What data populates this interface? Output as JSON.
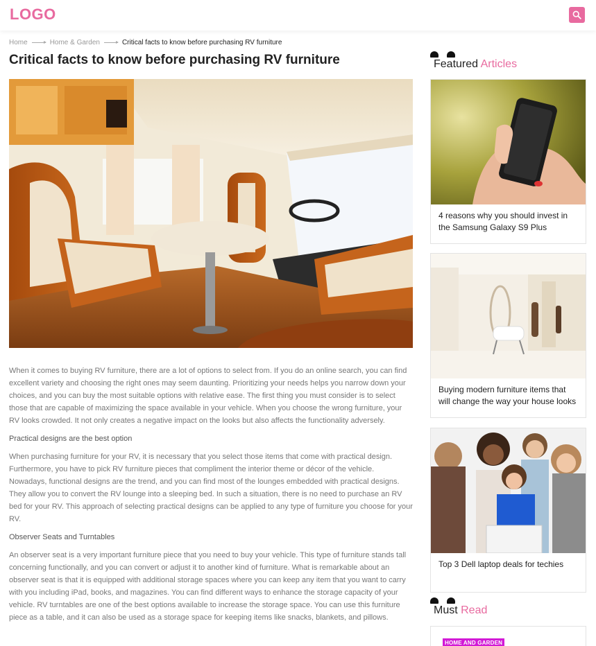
{
  "header": {
    "logo": "LOGO",
    "search_icon": "search-icon",
    "accent_color": "#e86a9f"
  },
  "breadcrumb": {
    "items": [
      "Home",
      "Home & Garden"
    ],
    "current": "Critical facts to know before purchasing RV furniture"
  },
  "article": {
    "title": "Critical facts to know before purchasing RV furniture",
    "hero_alt": "RV interior with orange seats and table",
    "paragraphs": [
      "When it comes to buying RV furniture, there are a lot of options to select from. If you do an online search, you can find excellent variety and choosing the right ones may seem daunting. Prioritizing your needs helps you narrow down your choices, and you can buy the most suitable options with relative ease. The first thing you must consider is to select those that are capable of maximizing the space available in your vehicle. When you choose the wrong furniture, your RV looks crowded. It not only creates a negative impact on the looks but also affects the functionality adversely.",
      "Practical designs are the best option",
      "When purchasing furniture for your RV, it is necessary that you select those items that come with practical design. Furthermore, you have to pick RV furniture pieces that compliment the interior theme or décor of the vehicle. Nowadays, functional designs are the trend, and you can find most of the lounges embedded with practical designs. They allow you to convert the RV lounge into a sleeping bed. In such a situation, there is no need to purchase an RV bed for your RV. This approach of selecting practical designs can be applied to any type of furniture you choose for your RV.",
      "Observer Seats and Turntables",
      "An observer seat is a very important furniture piece that you need to buy your vehicle. This type of furniture stands tall concerning functionally, and you can convert or adjust it to another kind of furniture. What is remarkable about an observer seat is that it is equipped with additional storage spaces where you can keep any item that you want to carry with you including iPad, books, and magazines. You can find different ways to enhance the storage capacity of your vehicle. RV turntables are one of the best options available to increase the storage space. You can use this furniture piece as a table, and it can also be used as a storage space for keeping items like snacks, blankets, and pillows."
    ]
  },
  "sidebar": {
    "featured": {
      "title_plain": "Featured",
      "title_accent": "Articles",
      "cards": [
        {
          "caption": "4 reasons why you should invest in the Samsung Galaxy S9 Plus"
        },
        {
          "caption": "Buying modern furniture items that will change the way your house looks"
        },
        {
          "caption": "Top 3 Dell laptop deals for techies"
        }
      ]
    },
    "must_read": {
      "title_plain": "Must",
      "title_accent": "Read",
      "badge": "HOME AND GARDEN",
      "badge_color": "#d21ad6"
    }
  }
}
